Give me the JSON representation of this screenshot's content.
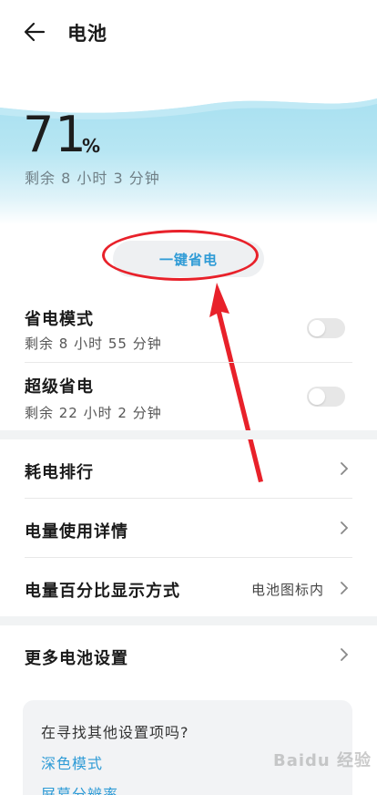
{
  "header": {
    "title": "电池",
    "back_icon": "arrow-left-icon"
  },
  "battery": {
    "percent": "71",
    "percent_unit": "%",
    "remaining": "剩余 8 小时 3 分钟",
    "panel_color": "#b7e6f3"
  },
  "one_key_button": {
    "label": "一键省电",
    "color": "#2e9bd6"
  },
  "power_modes": [
    {
      "title": "省电模式",
      "subtitle": "剩余 8 小时 55 分钟",
      "enabled": false
    },
    {
      "title": "超级省电",
      "subtitle": "剩余 22 小时 2 分钟",
      "enabled": false
    }
  ],
  "menu": [
    {
      "label": "耗电排行"
    },
    {
      "label": "电量使用详情"
    },
    {
      "label": "电量百分比显示方式",
      "value": "电池图标内"
    }
  ],
  "more": {
    "label": "更多电池设置"
  },
  "suggestions": {
    "title": "在寻找其他设置项吗?",
    "links": [
      "深色模式",
      "屏幕分辨率"
    ]
  },
  "annotation": {
    "color": "#e8212a"
  },
  "watermark": "Baidu 经验"
}
